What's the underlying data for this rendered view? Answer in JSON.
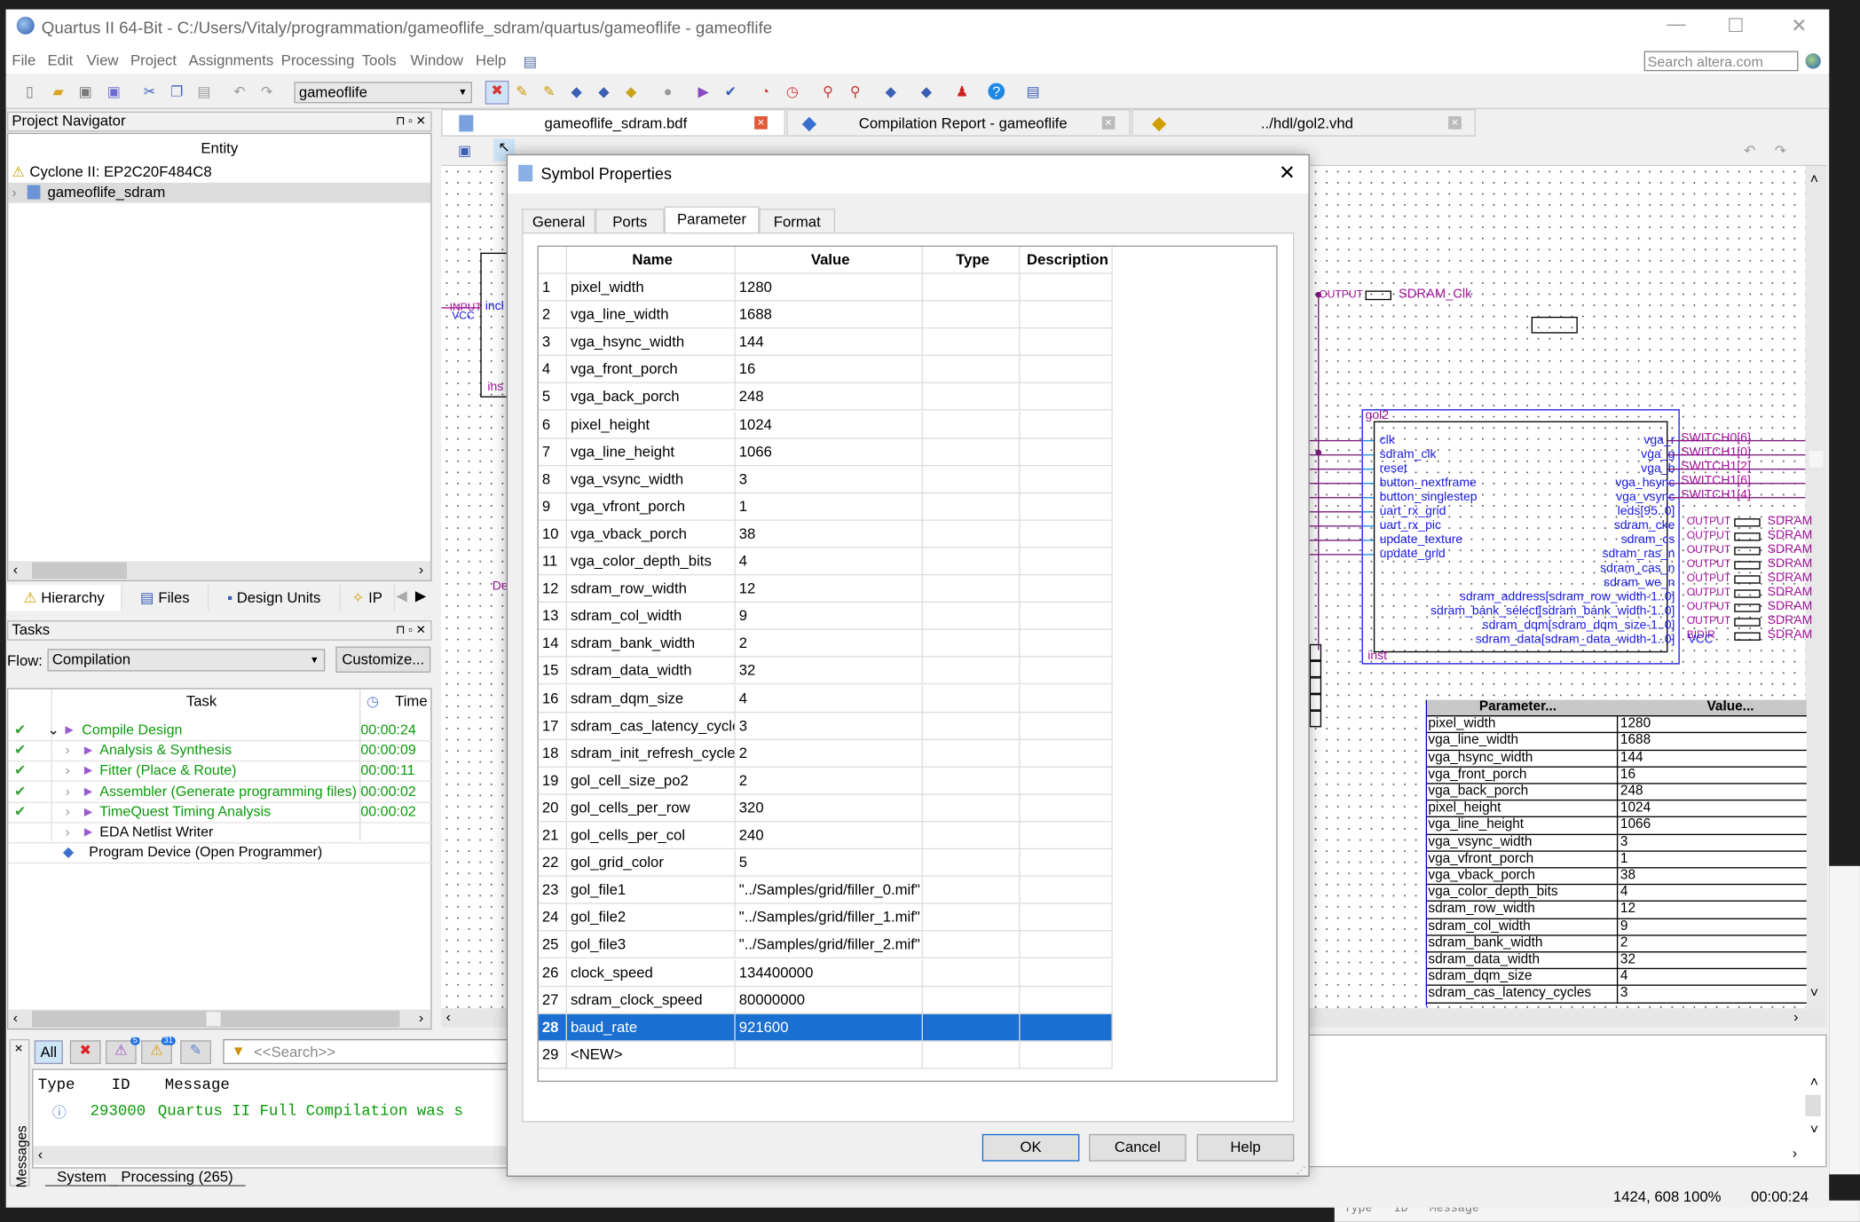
{
  "window": {
    "title": "Quartus II 64-Bit - C:/Users/Vitaly/programmation/gameoflife_sdram/quartus/gameoflife - gameoflife",
    "controls": [
      "—",
      "☐",
      "✕"
    ]
  },
  "menu": [
    "File",
    "Edit",
    "View",
    "Project",
    "Assignments",
    "Processing",
    "Tools",
    "Window",
    "Help"
  ],
  "search": {
    "placeholder": "Search altera.com"
  },
  "toolbar": {
    "revision": "gameoflife"
  },
  "navigator": {
    "title": "Project Navigator",
    "column": "Entity",
    "device": "Cyclone II: EP2C20F484C8",
    "entity": "gameoflife_sdram",
    "tabs": [
      "Hierarchy",
      "Files",
      "Design Units",
      "IP"
    ]
  },
  "tasks": {
    "title": "Tasks",
    "flow_label": "Flow:",
    "flow_value": "Compilation",
    "customize": "Customize...",
    "col_task": "Task",
    "col_time": "Time",
    "rows": [
      {
        "name": "Compile Design",
        "time": "00:00:24",
        "done": true,
        "level": 0
      },
      {
        "name": "Analysis & Synthesis",
        "time": "00:00:09",
        "done": true,
        "level": 1
      },
      {
        "name": "Fitter (Place & Route)",
        "time": "00:00:11",
        "done": true,
        "level": 1
      },
      {
        "name": "Assembler (Generate programming files)",
        "time": "00:00:02",
        "done": true,
        "level": 1
      },
      {
        "name": "TimeQuest Timing Analysis",
        "time": "00:00:02",
        "done": true,
        "level": 1
      },
      {
        "name": "EDA Netlist Writer",
        "time": "",
        "done": false,
        "level": 1
      },
      {
        "name": "Program Device (Open Programmer)",
        "time": "",
        "done": false,
        "level": 2
      }
    ]
  },
  "messages": {
    "side_label": "Messages",
    "all": "All",
    "badge_warn_critical": "5",
    "badge_warn": "31",
    "search_placeholder": "<<Search>>",
    "col_type": "Type",
    "col_id": "ID",
    "col_message": "Message",
    "row_id": "293000",
    "row_message": "Quartus II Full Compilation was s",
    "tabs": [
      "System",
      "Processing (265)"
    ]
  },
  "doc_tabs": [
    "gameoflife_sdram.bdf",
    "Compilation Report - gameoflife",
    "../hdl/gol2.vhd"
  ],
  "status": {
    "coords": "1424, 608",
    "zoom": "100%",
    "time": "00:00:24"
  },
  "behind_window": {
    "cols": [
      "Type",
      "ID",
      "Message"
    ]
  },
  "schematic": {
    "clk_output": "OUTPUT",
    "clk_pin": "SDRAM_Clk",
    "left_labels": [
      "INPUT",
      "VCC",
      "incl",
      "ins",
      "De"
    ],
    "block_name": "gol2",
    "block_inst": "inst",
    "inputs": [
      "clk",
      "sdram_clk",
      "reset",
      "button_nextframe",
      "button_singlestep",
      "uart_rx_grid",
      "uart_rx_pic",
      "update_texture",
      "update_grid"
    ],
    "outputs": [
      "vga_r",
      "vga_g",
      "vga_b",
      "vga_hsync",
      "vga_vsync",
      "leds[95..0]",
      "sdram_cke",
      "sdram_cs",
      "sdram_ras_n",
      "sdram_cas_n",
      "sdram_we_n",
      "sdram_address[sdram_row_width-1..0]",
      "sdram_bank_select[sdram_bank_width-1..0]",
      "sdram_dqm[sdram_dqm_size-1..0]",
      "sdram_data[sdram_data_width-1..0]"
    ],
    "switch_nets": [
      "SWITCH0[6]",
      "SWITCH1[0]",
      "SWITCH1[2]",
      "SWITCH1[6]",
      "SWITCH1[4]"
    ],
    "out_pins": [
      "OUTPUT",
      "OUTPUT",
      "OUTPUT",
      "OUTPUT",
      "OUTPUT",
      "OUTPUT",
      "OUTPUT",
      "OUTPUT",
      "BIDIR"
    ],
    "out_pin_name": "SDRAM",
    "vcc": "VCC",
    "param_header": [
      "Parameter...",
      "Value..."
    ],
    "params": [
      [
        "pixel_width",
        "1280"
      ],
      [
        "vga_line_width",
        "1688"
      ],
      [
        "vga_hsync_width",
        "144"
      ],
      [
        "vga_front_porch",
        "16"
      ],
      [
        "vga_back_porch",
        "248"
      ],
      [
        "pixel_height",
        "1024"
      ],
      [
        "vga_line_height",
        "1066"
      ],
      [
        "vga_vsync_width",
        "3"
      ],
      [
        "vga_vfront_porch",
        "1"
      ],
      [
        "vga_vback_porch",
        "38"
      ],
      [
        "vga_color_depth_bits",
        "4"
      ],
      [
        "sdram_row_width",
        "12"
      ],
      [
        "sdram_col_width",
        "9"
      ],
      [
        "sdram_bank_width",
        "2"
      ],
      [
        "sdram_data_width",
        "32"
      ],
      [
        "sdram_dqm_size",
        "4"
      ],
      [
        "sdram_cas_latency_cycles",
        "3"
      ]
    ]
  },
  "dialog": {
    "title": "Symbol Properties",
    "tabs": [
      "General",
      "Ports",
      "Parameter",
      "Format"
    ],
    "active_tab": "Parameter",
    "columns": [
      "Name",
      "Value",
      "Type",
      "Description"
    ],
    "selected_row": 28,
    "selection_color": "#1a6fd1",
    "rows": [
      [
        "1",
        "pixel_width",
        "1280"
      ],
      [
        "2",
        "vga_line_width",
        "1688"
      ],
      [
        "3",
        "vga_hsync_width",
        "144"
      ],
      [
        "4",
        "vga_front_porch",
        "16"
      ],
      [
        "5",
        "vga_back_porch",
        "248"
      ],
      [
        "6",
        "pixel_height",
        "1024"
      ],
      [
        "7",
        "vga_line_height",
        "1066"
      ],
      [
        "8",
        "vga_vsync_width",
        "3"
      ],
      [
        "9",
        "vga_vfront_porch",
        "1"
      ],
      [
        "10",
        "vga_vback_porch",
        "38"
      ],
      [
        "11",
        "vga_color_depth_bits",
        "4"
      ],
      [
        "12",
        "sdram_row_width",
        "12"
      ],
      [
        "13",
        "sdram_col_width",
        "9"
      ],
      [
        "14",
        "sdram_bank_width",
        "2"
      ],
      [
        "15",
        "sdram_data_width",
        "32"
      ],
      [
        "16",
        "sdram_dqm_size",
        "4"
      ],
      [
        "17",
        "sdram_cas_latency_cycles",
        "3"
      ],
      [
        "18",
        "sdram_init_refresh_cycles",
        "2"
      ],
      [
        "19",
        "gol_cell_size_po2",
        "2"
      ],
      [
        "20",
        "gol_cells_per_row",
        "320"
      ],
      [
        "21",
        "gol_cells_per_col",
        "240"
      ],
      [
        "22",
        "gol_grid_color",
        "5"
      ],
      [
        "23",
        "gol_file1",
        "\"../Samples/grid/filler_0.mif\""
      ],
      [
        "24",
        "gol_file2",
        "\"../Samples/grid/filler_1.mif\""
      ],
      [
        "25",
        "gol_file3",
        "\"../Samples/grid/filler_2.mif\""
      ],
      [
        "26",
        "clock_speed",
        "134400000"
      ],
      [
        "27",
        "sdram_clock_speed",
        "80000000"
      ],
      [
        "28",
        "baud_rate",
        "921600"
      ],
      [
        "29",
        "<NEW>",
        ""
      ]
    ],
    "ok": "OK",
    "cancel": "Cancel",
    "help": "Help"
  }
}
